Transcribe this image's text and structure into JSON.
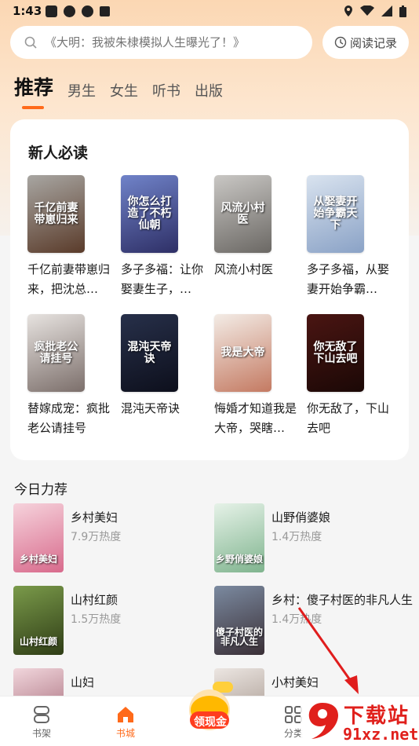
{
  "status_bar": {
    "time": "1:43"
  },
  "search": {
    "placeholder": "《大明：我被朱棣模拟人生曝光了！》"
  },
  "history_button": {
    "label": "阅读记录"
  },
  "tabs": [
    {
      "label": "推荐"
    },
    {
      "label": "男生"
    },
    {
      "label": "女生"
    },
    {
      "label": "听书"
    },
    {
      "label": "出版"
    }
  ],
  "new_reader": {
    "title": "新人必读",
    "books": [
      {
        "title": "千亿前妻带崽归来，把沈总…",
        "cover_text": "千亿前妻带崽归来",
        "cover_colors": [
          "#a8a6a2",
          "#5a3b2a"
        ]
      },
      {
        "title": "多子多福：让你娶妻生子，…",
        "cover_text": "你怎么打造了不朽仙朝",
        "cover_colors": [
          "#7083c9",
          "#2e2f66"
        ]
      },
      {
        "title": "风流小村医",
        "cover_text": "风流小村医",
        "cover_colors": [
          "#c9c7c4",
          "#6b6864"
        ]
      },
      {
        "title": "多子多福，从娶妻开始争霸…",
        "cover_text": "从娶妻开始争霸天下",
        "cover_colors": [
          "#d9e3ef",
          "#8aa2c6"
        ]
      },
      {
        "title": "替嫁成宠：疯批老公请挂号",
        "cover_text": "疯批老公请挂号",
        "cover_colors": [
          "#e7e3e0",
          "#7c6f6b"
        ]
      },
      {
        "title": "混沌天帝诀",
        "cover_text": "混沌天帝诀",
        "cover_colors": [
          "#27304a",
          "#0d0f1c"
        ]
      },
      {
        "title": "悔婚才知道我是大帝，哭瞎…",
        "cover_text": "我是大帝",
        "cover_colors": [
          "#f3ece6",
          "#c47a62"
        ]
      },
      {
        "title": "你无敌了，下山去吧",
        "cover_text": "你无敌了下山去吧",
        "cover_colors": [
          "#4a1512",
          "#1b0806"
        ]
      }
    ]
  },
  "today": {
    "title": "今日力荐",
    "items": [
      {
        "title": "乡村美妇",
        "heat": "7.9万热度",
        "cover_text": "乡村美妇",
        "cover_colors": [
          "#f6d3dc",
          "#d86a8c"
        ]
      },
      {
        "title": "山野俏婆娘",
        "heat": "1.4万热度",
        "cover_text": "乡野俏婆娘",
        "cover_colors": [
          "#e6f2e8",
          "#7fb48e"
        ]
      },
      {
        "title": "山村红颜",
        "heat": "1.5万热度",
        "cover_text": "山村红颜",
        "cover_colors": [
          "#7a9a4a",
          "#2f3d16"
        ]
      },
      {
        "title": "乡村：傻子村医的非凡人生",
        "heat": "1.4万热度",
        "cover_text": "傻子村医的非凡人生",
        "cover_colors": [
          "#7b8aa0",
          "#3a2f36"
        ]
      },
      {
        "title": "山妇",
        "heat": "",
        "cover_text": "",
        "cover_colors": [
          "#f1d6dc",
          "#9a5a6a"
        ]
      },
      {
        "title": "小村美妇",
        "heat": "",
        "cover_text": "",
        "cover_colors": [
          "#ece6e2",
          "#9a8a80"
        ]
      }
    ]
  },
  "bottom_nav": [
    {
      "label": "书架",
      "icon": "bookshelf-icon"
    },
    {
      "label": "书城",
      "icon": "home-icon"
    },
    {
      "label": "领现金",
      "icon": "cash-icon"
    },
    {
      "label": "分类",
      "icon": "category-icon"
    }
  ],
  "watermark": {
    "text": "下载站",
    "url_text": "91xz.net",
    "logo": "9"
  },
  "colors": {
    "accent": "#ff6a1a",
    "watermark_red": "#e0201c"
  }
}
